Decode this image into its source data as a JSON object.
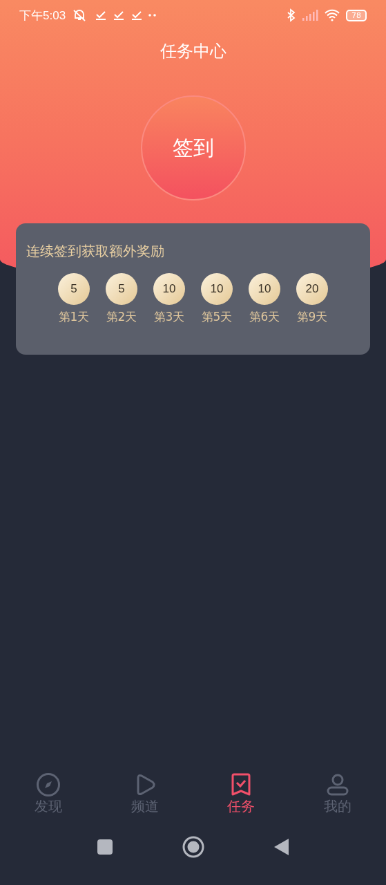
{
  "status_bar": {
    "time": "下午5:03",
    "battery": "78"
  },
  "title": "任务中心",
  "sign_in_button": "签到",
  "bonus_card": {
    "title": "连续签到获取额外奖励",
    "rewards": [
      {
        "amount": "5",
        "day": "第1天"
      },
      {
        "amount": "5",
        "day": "第2天"
      },
      {
        "amount": "10",
        "day": "第3天"
      },
      {
        "amount": "10",
        "day": "第5天"
      },
      {
        "amount": "10",
        "day": "第6天"
      },
      {
        "amount": "20",
        "day": "第9天"
      }
    ]
  },
  "tabs": [
    {
      "label": "发现",
      "kind": "compass",
      "selected": false
    },
    {
      "label": "频道",
      "kind": "play",
      "selected": false
    },
    {
      "label": "任务",
      "kind": "task",
      "selected": true
    },
    {
      "label": "我的",
      "kind": "person",
      "selected": false
    }
  ]
}
